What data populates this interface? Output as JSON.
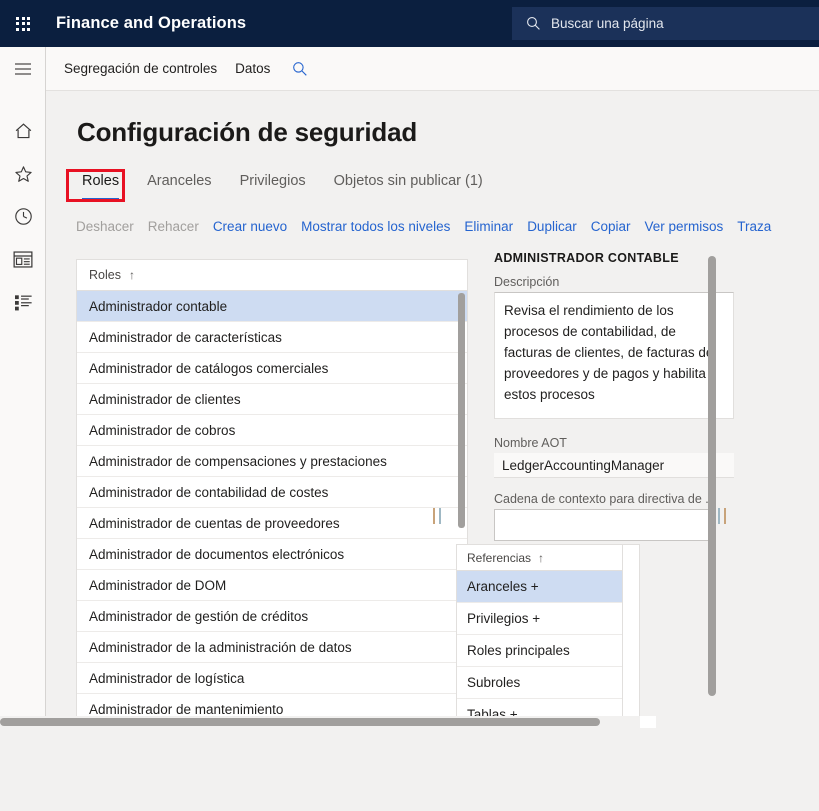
{
  "appbar": {
    "waffle_icon": "app-launcher-icon",
    "title": "Finance and Operations",
    "search": {
      "icon": "search-icon",
      "placeholder": "Buscar una página",
      "value": ""
    }
  },
  "rail": {
    "hamburger_icon": "hamburger-menu-icon",
    "items": [
      {
        "icon": "home-icon",
        "name": "home"
      },
      {
        "icon": "star-icon",
        "name": "favorites"
      },
      {
        "icon": "clock-icon",
        "name": "recent"
      },
      {
        "icon": "workspace-icon",
        "name": "workspaces"
      },
      {
        "icon": "list-icon",
        "name": "modules"
      }
    ]
  },
  "nav": {
    "items": [
      {
        "label": "Segregación de controles"
      },
      {
        "label": "Datos"
      }
    ],
    "search_icon": "search-icon"
  },
  "page": {
    "title": "Configuración de seguridad",
    "tabs": [
      {
        "label": "Roles",
        "active": true,
        "highlighted": true
      },
      {
        "label": "Aranceles",
        "active": false,
        "highlighted": false
      },
      {
        "label": "Privilegios",
        "active": false,
        "highlighted": false
      },
      {
        "label": "Objetos sin publicar (1)",
        "active": false,
        "highlighted": false
      }
    ],
    "toolbar": [
      {
        "label": "Deshacer",
        "disabled": true
      },
      {
        "label": "Rehacer",
        "disabled": true
      },
      {
        "label": "Crear nuevo",
        "disabled": false
      },
      {
        "label": "Mostrar todos los niveles",
        "disabled": false
      },
      {
        "label": "Eliminar",
        "disabled": false
      },
      {
        "label": "Duplicar",
        "disabled": false
      },
      {
        "label": "Copiar",
        "disabled": false
      },
      {
        "label": "Ver permisos",
        "disabled": false
      },
      {
        "label": "Traza",
        "disabled": false
      }
    ]
  },
  "roles_list": {
    "header": "Roles",
    "sort_arrow": "↑",
    "rows": [
      {
        "label": "Administrador contable",
        "selected": true
      },
      {
        "label": "Administrador de características",
        "selected": false
      },
      {
        "label": "Administrador de catálogos comerciales",
        "selected": false
      },
      {
        "label": "Administrador de clientes",
        "selected": false
      },
      {
        "label": "Administrador de cobros",
        "selected": false
      },
      {
        "label": "Administrador de compensaciones y prestaciones",
        "selected": false
      },
      {
        "label": "Administrador de contabilidad de costes",
        "selected": false
      },
      {
        "label": "Administrador de cuentas de proveedores",
        "selected": false
      },
      {
        "label": "Administrador de documentos electrónicos",
        "selected": false
      },
      {
        "label": "Administrador de DOM",
        "selected": false
      },
      {
        "label": "Administrador de gestión de créditos",
        "selected": false
      },
      {
        "label": "Administrador de la administración de datos",
        "selected": false
      },
      {
        "label": "Administrador de logística",
        "selected": false
      },
      {
        "label": "Administrador de mantenimiento",
        "selected": false
      }
    ]
  },
  "detail": {
    "title": "ADMINISTRADOR CONTABLE",
    "description_label": "Descripción",
    "description_value": "Revisa el rendimiento de los procesos de contabilidad, de facturas de clientes, de facturas de proveedores y de pagos y habilita estos procesos",
    "aot_label": "Nombre AOT",
    "aot_value": "LedgerAccountingManager",
    "context_label": "Cadena de contexto para directiva de ...",
    "context_value": ""
  },
  "references": {
    "header": "Referencias",
    "sort_arrow": "↑",
    "rows": [
      {
        "label": "Aranceles +",
        "selected": true
      },
      {
        "label": "Privilegios +",
        "selected": false
      },
      {
        "label": "Roles principales",
        "selected": false
      },
      {
        "label": "Subroles",
        "selected": false
      },
      {
        "label": "Tablas +",
        "selected": false
      }
    ]
  },
  "colors": {
    "appbar_bg": "#0b1f3f",
    "search_bg": "#1b3159",
    "accent_link": "#2564cf",
    "selection_bg": "#cedcf2",
    "annotation_red": "#e81123",
    "page_bg": "#f2f1f0"
  }
}
